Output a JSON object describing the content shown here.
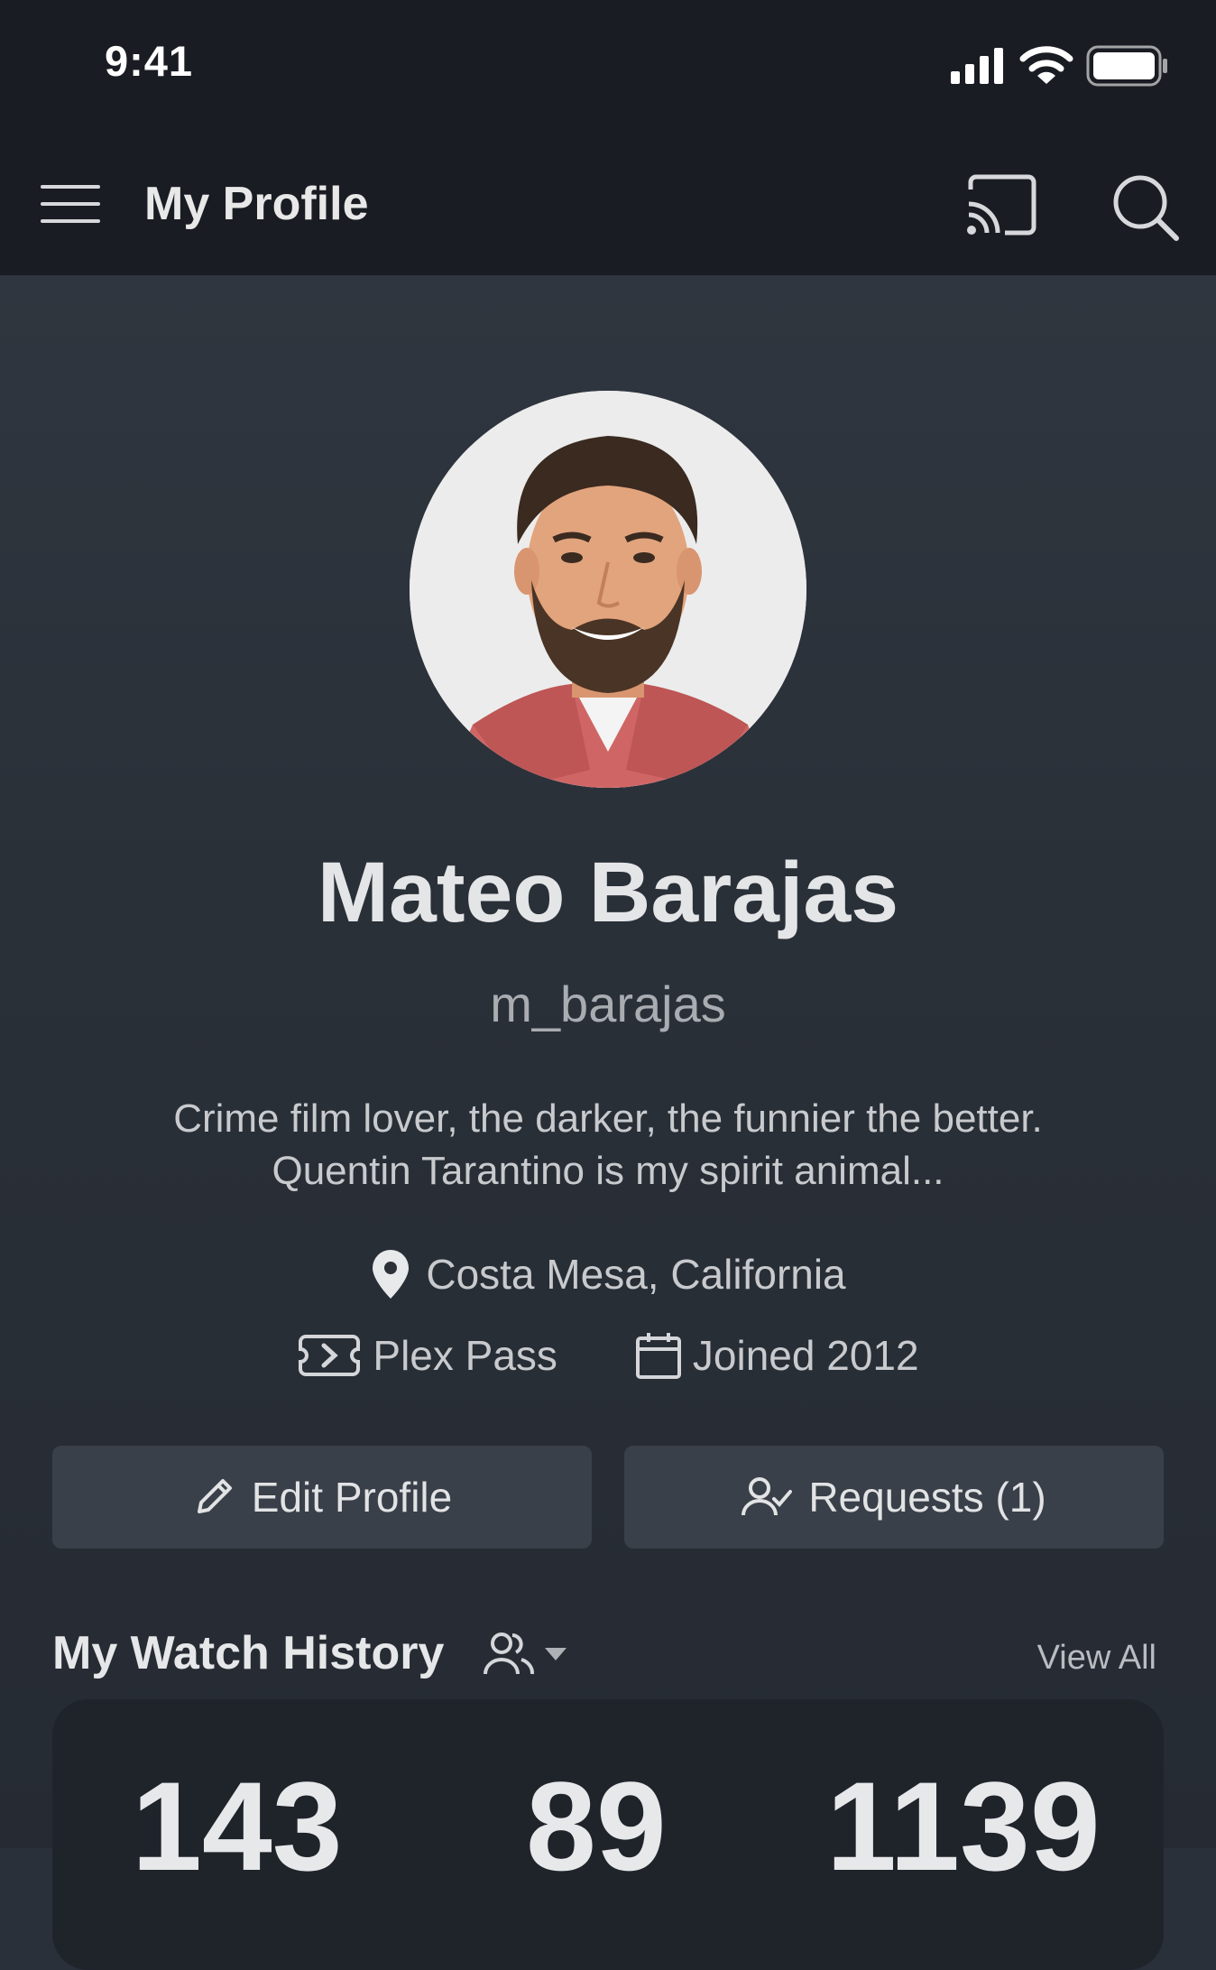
{
  "status_bar": {
    "time": "9:41"
  },
  "app_bar": {
    "title": "My Profile"
  },
  "profile": {
    "name": "Mateo Barajas",
    "username": "m_barajas",
    "bio_line1": "Crime film lover, the darker, the funnier the better.",
    "bio_line2": "Quentin Tarantino is my spirit animal...",
    "location": "Costa Mesa, California",
    "plan": "Plex Pass",
    "joined": "Joined 2012"
  },
  "actions": {
    "edit_label": "Edit Profile",
    "requests_label": "Requests (1)"
  },
  "watch_history": {
    "title": "My Watch History",
    "view_all": "View All",
    "stats": [
      "143",
      "89",
      "1139"
    ]
  },
  "colors": {
    "background": "#2a3039",
    "appbar": "#191c22",
    "button": "#3a4049"
  }
}
